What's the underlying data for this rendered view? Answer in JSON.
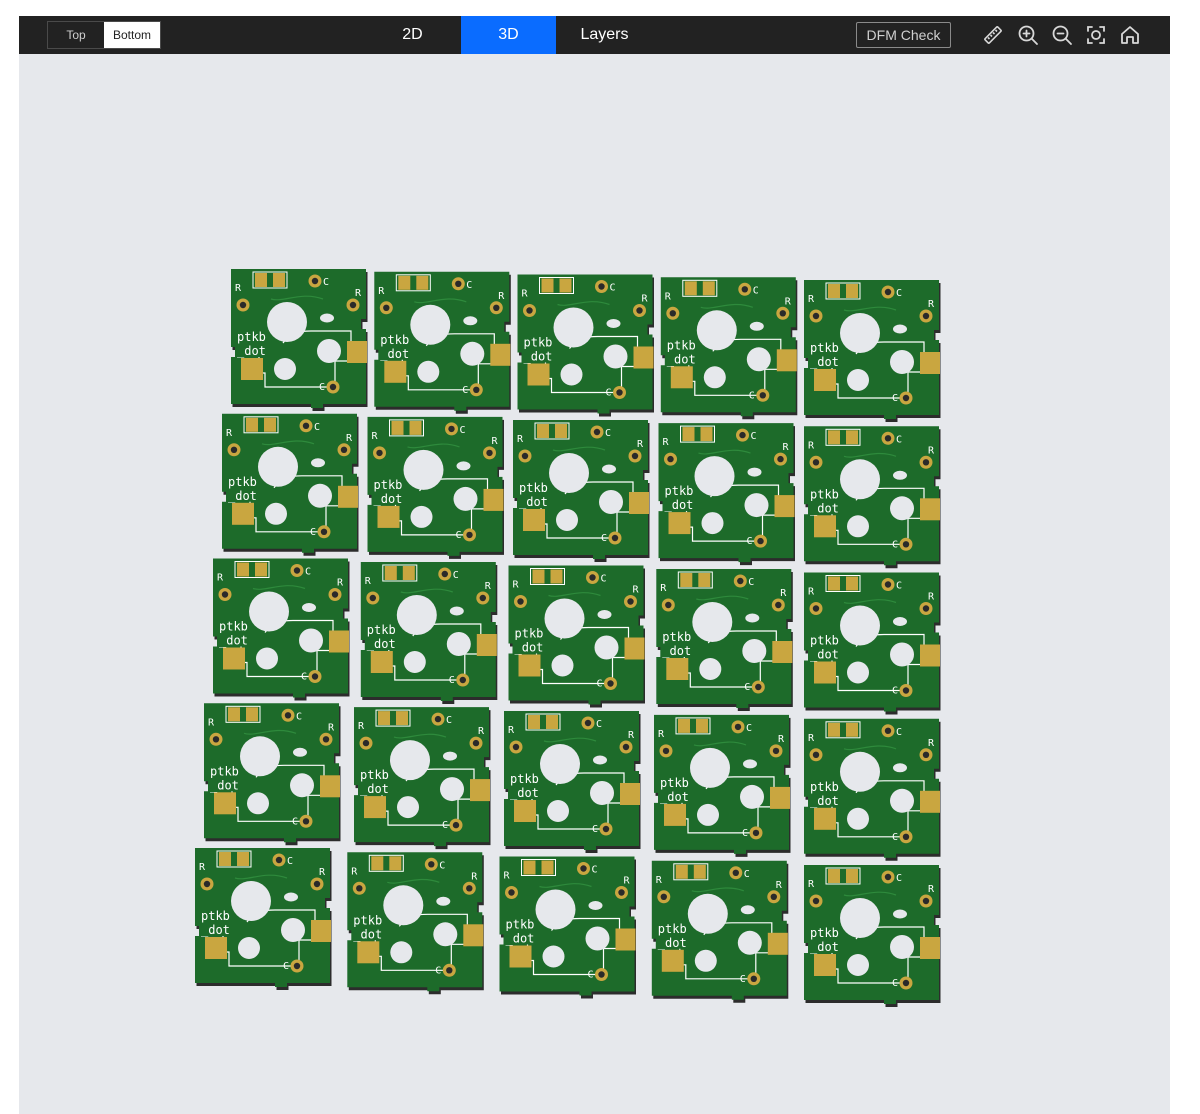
{
  "toolbar": {
    "side_top_label": "Top",
    "side_bottom_label": "Bottom",
    "view_2d_label": "2D",
    "view_3d_label": "3D",
    "view_layers_label": "Layers",
    "dfm_check_label": "DFM Check",
    "tools": [
      "ruler-icon",
      "zoom-in-icon",
      "zoom-out-icon",
      "fit-view-icon",
      "home-icon"
    ]
  },
  "viewer": {
    "active_side": "Bottom",
    "active_view": "3D",
    "board_rows": 5,
    "board_cols": 5,
    "board_label_line1": "ptkb",
    "board_label_line2": "_dot",
    "resistor_mark": "R",
    "capacitor_mark": "C"
  },
  "colors": {
    "toolbar_bg": "#222222",
    "accent": "#0a6cff",
    "viewport_bg": "#e6e8ec",
    "board_green": "#1d6b2a",
    "board_edge": "#2c2c2c",
    "pad_gold": "#c9a640",
    "silkscreen": "#ffffff"
  }
}
